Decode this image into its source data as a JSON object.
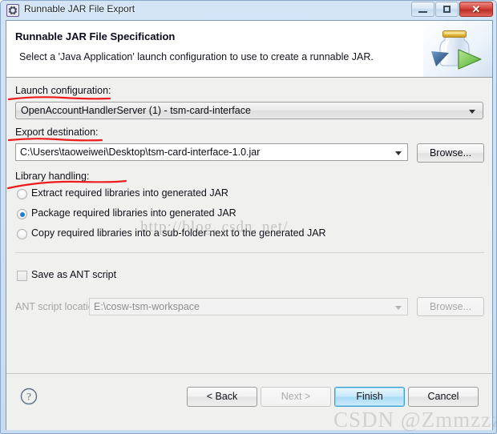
{
  "window": {
    "title": "Runnable JAR File Export",
    "icon": "eclipse-gear-icon",
    "controls": {
      "minimize": "—",
      "maximize": "□",
      "close": "✕"
    }
  },
  "header": {
    "title": "Runnable JAR File Specification",
    "description": "Select a 'Java Application' launch configuration to use to create a runnable JAR.",
    "graphic": "jar-export-banner-icon"
  },
  "form": {
    "launch_configuration": {
      "label": "Launch configuration:",
      "value": "OpenAccountHandlerServer (1) - tsm-card-interface"
    },
    "export_destination": {
      "label": "Export destination:",
      "value": "C:\\Users\\taoweiwei\\Desktop\\tsm-card-interface-1.0.jar",
      "browse_label": "Browse..."
    },
    "library_handling": {
      "label": "Library handling:",
      "options": [
        {
          "label": "Extract required libraries into generated JAR",
          "selected": false
        },
        {
          "label": "Package required libraries into generated JAR",
          "selected": true
        },
        {
          "label": "Copy required libraries into a sub-folder next to the generated JAR",
          "selected": false
        }
      ]
    },
    "save_as_ant": {
      "label": "Save as ANT script",
      "checked": false
    },
    "ant_script_location": {
      "label": "ANT script location:",
      "value": "E:\\cosw-tsm-workspace",
      "browse_label": "Browse...",
      "enabled": false
    }
  },
  "footer": {
    "help_icon": "help-question-icon",
    "buttons": [
      {
        "label": "< Back",
        "state": "enabled"
      },
      {
        "label": "Next >",
        "state": "disabled"
      },
      {
        "label": "Finish",
        "state": "default"
      },
      {
        "label": "Cancel",
        "state": "enabled"
      }
    ]
  },
  "watermarks": {
    "url": "http://blog. csdn. net/",
    "author": "CSDN @Zmmzzz"
  },
  "colors": {
    "annotation_red": "#ee1c1c",
    "radio_blue": "#1a7fd4",
    "close_red": "#d6453c",
    "default_button_blue": "#3c9fd6",
    "titlebar_blue": "#cfe1f3"
  }
}
